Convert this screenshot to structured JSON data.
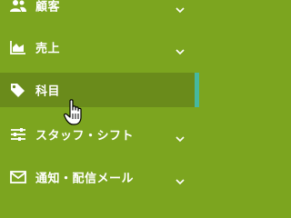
{
  "menu": {
    "items": [
      {
        "label": "顧客",
        "icon": "users-icon",
        "expandable": true
      },
      {
        "label": "売上",
        "icon": "area-chart-icon",
        "expandable": true
      },
      {
        "label": "科目",
        "icon": "tags-icon",
        "expandable": false,
        "active": true
      },
      {
        "label": "スタッフ・シフト",
        "icon": "sliders-icon",
        "expandable": true
      },
      {
        "label": "通知・配信メール",
        "icon": "envelope-icon",
        "expandable": true
      }
    ]
  },
  "colors": {
    "background": "#7ca51f",
    "active_background": "#6a8b1b",
    "active_indicator": "#46b8a0",
    "text": "#ffffff"
  },
  "cursor": "hand-pointer-icon"
}
